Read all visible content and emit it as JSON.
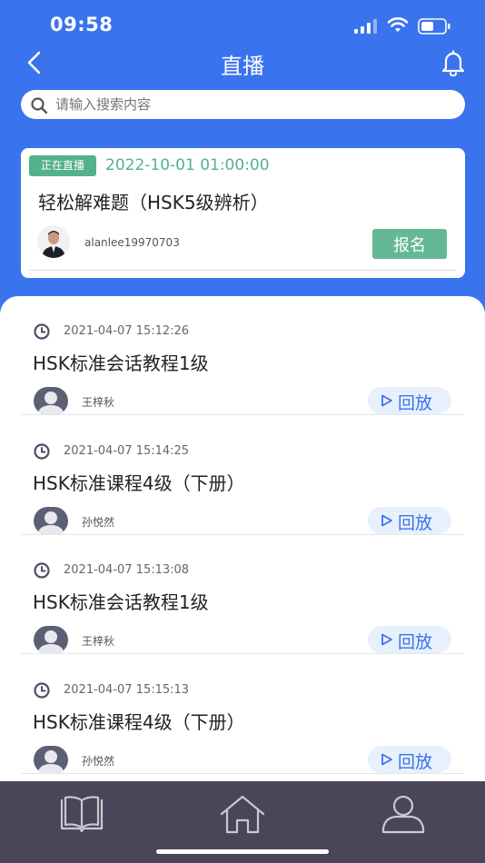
{
  "status_bar": {
    "time": "09:58"
  },
  "header": {
    "title": "直播"
  },
  "search": {
    "placeholder": "请输入搜索内容"
  },
  "live_card": {
    "badge": "正在直播",
    "datetime": "2022-10-01 01:00:00",
    "title": "轻松解难题（HSK5级辨析）",
    "user": "alanlee19970703",
    "signup_label": "报名"
  },
  "playback_label": "回放",
  "items": [
    {
      "date": "2021-04-07 15:12:26",
      "title": "HSK标准会话教程1级",
      "user": "王梓秋"
    },
    {
      "date": "2021-04-07 15:14:25",
      "title": "HSK标准课程4级（下册）",
      "user": "孙悦然"
    },
    {
      "date": "2021-04-07 15:13:08",
      "title": "HSK标准会话教程1级",
      "user": "王梓秋"
    },
    {
      "date": "2021-04-07 15:15:13",
      "title": "HSK标准课程4级（下册）",
      "user": "孙悦然"
    }
  ],
  "tabbar": {
    "icons": [
      "book-icon",
      "home-icon",
      "user-icon"
    ]
  },
  "colors": {
    "primary": "#3a73ee",
    "live_green": "#53b28c",
    "tabbar": "#4a4558",
    "playback_bg": "#e7f0fc"
  }
}
